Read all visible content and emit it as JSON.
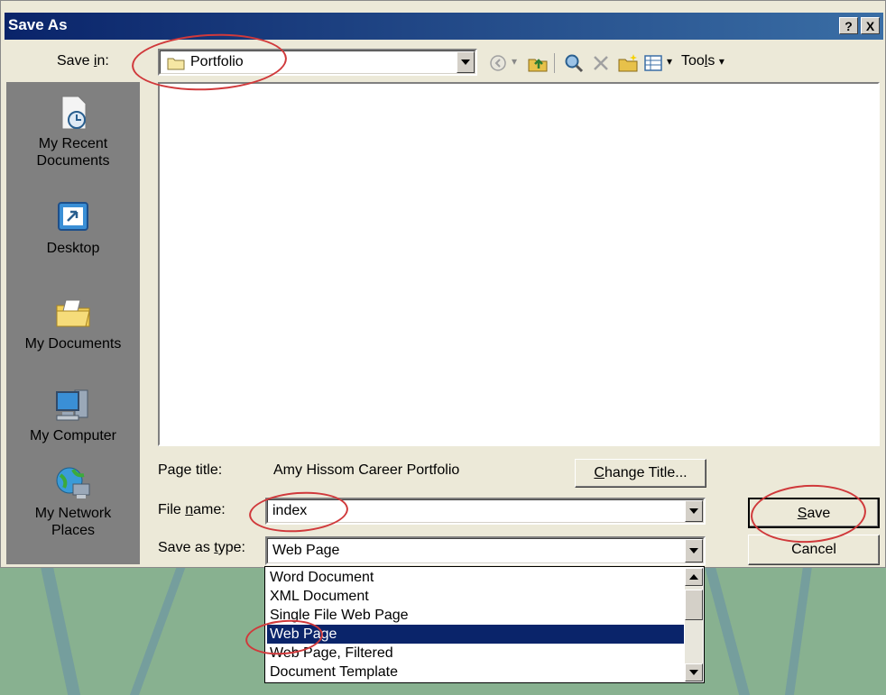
{
  "dialog": {
    "title": "Save As",
    "help_label": "?",
    "close_label": "X"
  },
  "save_in": {
    "label": "Save in:",
    "label_pre": "Save ",
    "label_ul": "i",
    "label_post": "n:",
    "value": "Portfolio"
  },
  "toolbar": {
    "tools_pre": "Too",
    "tools_ul": "l",
    "tools_post": "s"
  },
  "places": [
    {
      "label": "My Recent Documents",
      "line1": "My Recent",
      "line2": "Documents",
      "icon": "recent-documents-icon"
    },
    {
      "label": "Desktop",
      "icon": "desktop-icon"
    },
    {
      "label": "My Documents",
      "icon": "my-documents-icon"
    },
    {
      "label": "My Computer",
      "icon": "my-computer-icon"
    },
    {
      "label": "My Network Places",
      "line1": "My Network",
      "line2": "Places",
      "icon": "network-places-icon"
    }
  ],
  "page_title": {
    "label": "Page title:",
    "value": "Amy Hissom Career Portfolio",
    "change_button_ul": "C",
    "change_button_rest": "hange Title..."
  },
  "file_name": {
    "label_pre": "File ",
    "label_ul": "n",
    "label_post": "ame:",
    "value": "index"
  },
  "save_as_type": {
    "label_pre": "Save as ",
    "label_ul": "t",
    "label_post": "ype:",
    "value": "Web Page",
    "options": [
      "Word Document",
      "XML Document",
      "Single File Web Page",
      "Web Page",
      "Web Page, Filtered",
      "Document Template"
    ],
    "selected_index": 3
  },
  "buttons": {
    "save_ul": "S",
    "save_rest": "ave",
    "cancel": "Cancel"
  },
  "colors": {
    "title_bar": "#0a246a",
    "selection": "#0a246a",
    "annotation": "#d0393b",
    "dialog_bg": "#ece9d8"
  }
}
